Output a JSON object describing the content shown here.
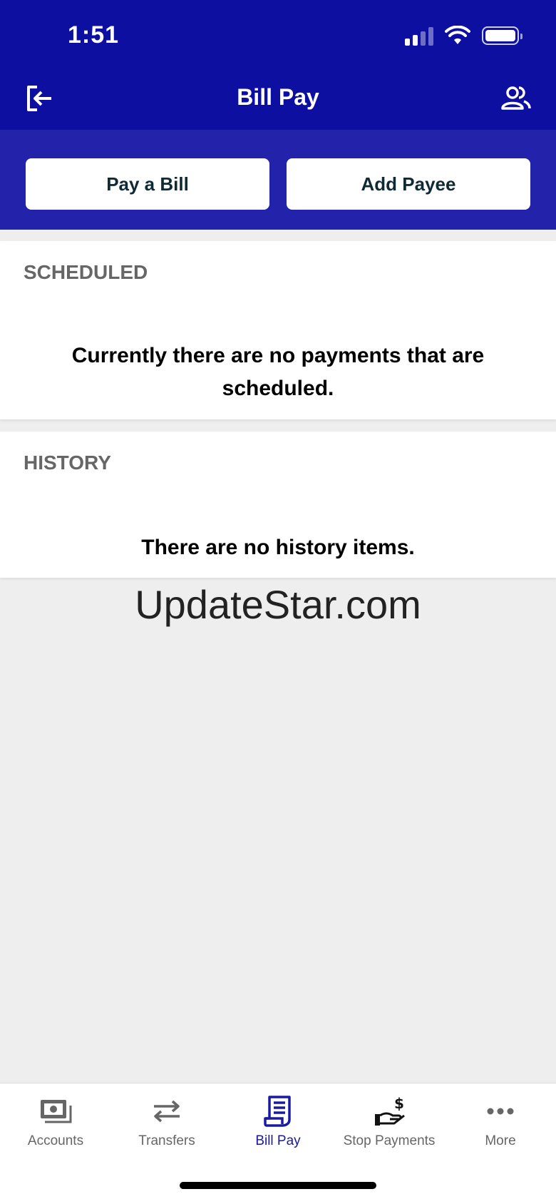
{
  "status": {
    "time": "1:51"
  },
  "header": {
    "title": "Bill Pay",
    "left_icon": "logout-icon",
    "right_icon": "users-icon"
  },
  "actions": {
    "pay_label": "Pay a Bill",
    "add_label": "Add Payee"
  },
  "scheduled": {
    "title": "SCHEDULED",
    "message": "Currently there are no payments that are scheduled."
  },
  "history": {
    "title": "HISTORY",
    "message": "There are no history items."
  },
  "watermark": "UpdateStar.com",
  "tabs": [
    {
      "label": "Accounts",
      "icon": "cash-icon",
      "active": false
    },
    {
      "label": "Transfers",
      "icon": "transfer-icon",
      "active": false
    },
    {
      "label": "Bill Pay",
      "icon": "bill-icon",
      "active": true
    },
    {
      "label": "Stop Payments",
      "icon": "hand-dollar-icon",
      "active": false
    },
    {
      "label": "More",
      "icon": "more-icon",
      "active": false
    }
  ],
  "colors": {
    "header_bg": "#0c0fa0",
    "action_bg": "#2222aa",
    "active_tab": "#1a1aa0",
    "inactive_tab": "#666666"
  }
}
